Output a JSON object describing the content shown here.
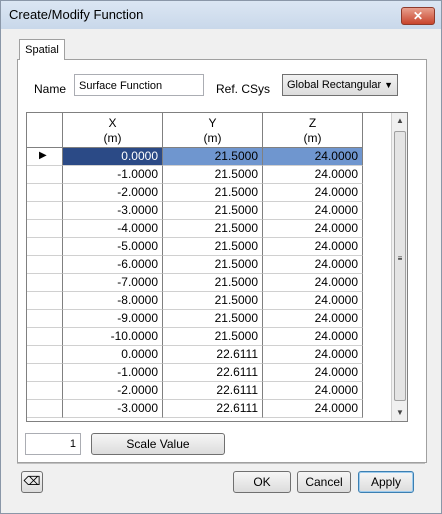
{
  "window": {
    "title": "Create/Modify Function",
    "close_glyph": "✕"
  },
  "tabs": [
    {
      "label": "Spatial"
    }
  ],
  "form": {
    "name_label": "Name",
    "name_value": "Surface Function",
    "ref_label": "Ref. CSys",
    "ref_value": "Global Rectangular"
  },
  "table": {
    "columns": [
      {
        "name": "X",
        "unit": "(m)"
      },
      {
        "name": "Y",
        "unit": "(m)"
      },
      {
        "name": "Z",
        "unit": "(m)"
      }
    ],
    "rows": [
      [
        "0.0000",
        "21.5000",
        "24.0000"
      ],
      [
        "-1.0000",
        "21.5000",
        "24.0000"
      ],
      [
        "-2.0000",
        "21.5000",
        "24.0000"
      ],
      [
        "-3.0000",
        "21.5000",
        "24.0000"
      ],
      [
        "-4.0000",
        "21.5000",
        "24.0000"
      ],
      [
        "-5.0000",
        "21.5000",
        "24.0000"
      ],
      [
        "-6.0000",
        "21.5000",
        "24.0000"
      ],
      [
        "-7.0000",
        "21.5000",
        "24.0000"
      ],
      [
        "-8.0000",
        "21.5000",
        "24.0000"
      ],
      [
        "-9.0000",
        "21.5000",
        "24.0000"
      ],
      [
        "-10.0000",
        "21.5000",
        "24.0000"
      ],
      [
        "0.0000",
        "22.6111",
        "24.0000"
      ],
      [
        "-1.0000",
        "22.6111",
        "24.0000"
      ],
      [
        "-2.0000",
        "22.6111",
        "24.0000"
      ],
      [
        "-3.0000",
        "22.6111",
        "24.0000"
      ]
    ],
    "current_row_marker": "▶"
  },
  "scale": {
    "value": "1",
    "button_label": "Scale Value"
  },
  "footer": {
    "ok_label": "OK",
    "cancel_label": "Cancel",
    "apply_label": "Apply"
  },
  "icons": {
    "eraser": "eraser-icon",
    "close": "close-icon"
  }
}
